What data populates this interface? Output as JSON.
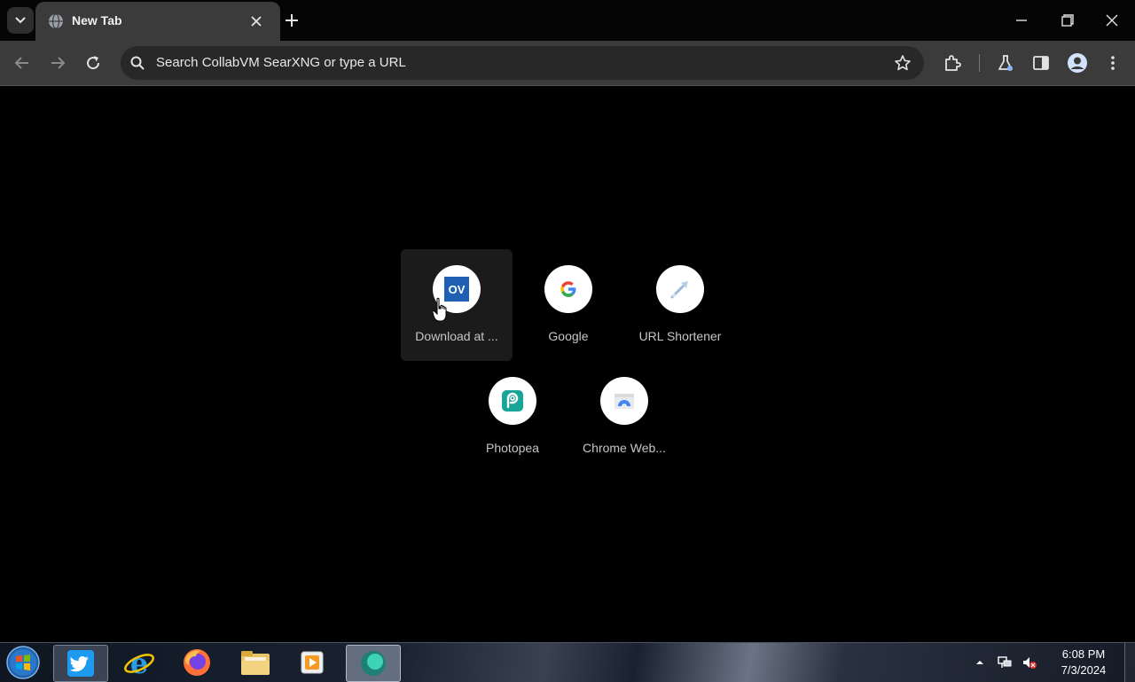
{
  "tabs": [
    {
      "title": "New Tab"
    }
  ],
  "toolbar": {
    "omnibox_placeholder": "Search CollabVM SearXNG or type a URL"
  },
  "shortcuts": [
    {
      "label": "Download at ...",
      "icon": "ov-icon"
    },
    {
      "label": "Google",
      "icon": "google-g-icon"
    },
    {
      "label": "URL Shortener",
      "icon": "url-shortener-icon"
    },
    {
      "label": "Photopea",
      "icon": "photopea-icon"
    },
    {
      "label": "Chrome Web...",
      "icon": "chrome-web-store-icon"
    }
  ],
  "taskbar": {
    "items": [
      "twitter-icon",
      "internet-explorer-icon",
      "firefox-icon",
      "file-explorer-icon",
      "media-player-icon",
      "collabvm-icon"
    ],
    "clock_time": "6:08 PM",
    "clock_date": "7/3/2024"
  },
  "colors": {
    "tab_bg": "#3b3b3b",
    "toolbar_bg": "#3b3b3b",
    "page_bg": "#000000",
    "omnibox_bg": "#282828"
  }
}
